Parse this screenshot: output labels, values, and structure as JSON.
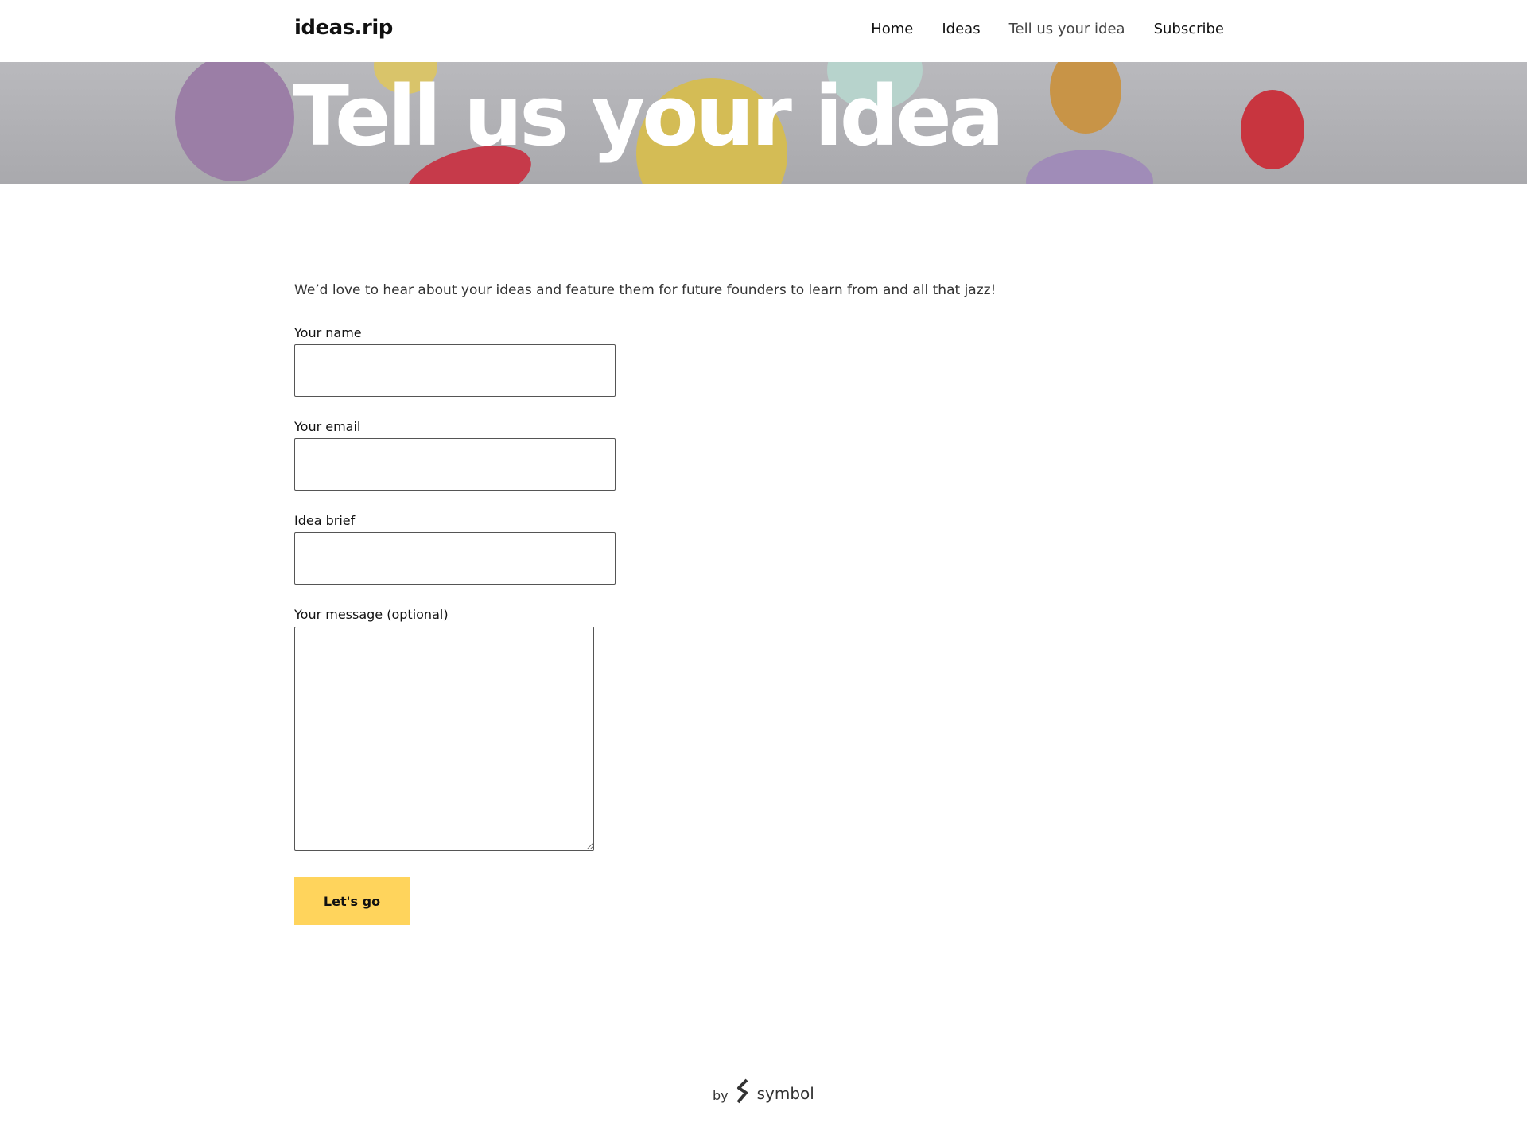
{
  "header": {
    "logo": "ideas.rip",
    "nav": [
      {
        "label": "Home",
        "active": false
      },
      {
        "label": "Ideas",
        "active": false
      },
      {
        "label": "Tell us your idea",
        "active": true
      },
      {
        "label": "Subscribe",
        "active": false
      }
    ]
  },
  "hero": {
    "title": "Tell us your idea"
  },
  "form": {
    "intro": "We’d love to hear about your ideas and feature them for future founders to learn from and all that jazz!",
    "name_label": "Your name",
    "name_value": "",
    "email_label": "Your email",
    "email_value": "",
    "brief_label": "Idea brief",
    "brief_value": "",
    "message_label": "Your message (optional)",
    "message_value": "",
    "submit_label": "Let's go"
  },
  "footer": {
    "by": "by",
    "brand": "symbol"
  },
  "colors": {
    "accent": "#ffd45c",
    "hero_overlay": "#b0b0b4"
  }
}
